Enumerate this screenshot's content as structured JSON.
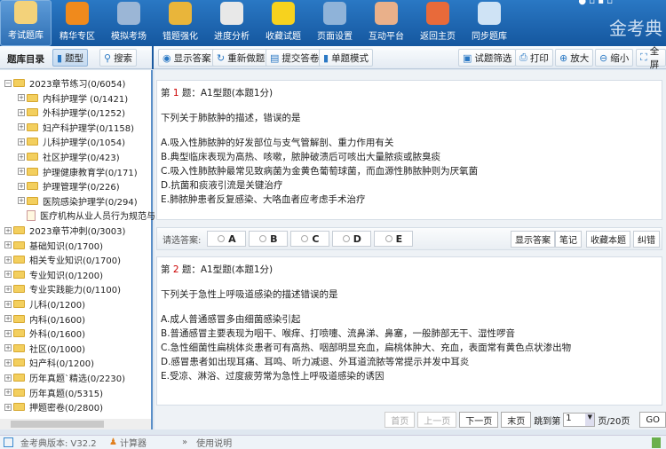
{
  "header": {
    "brand": "金考典",
    "nav": [
      {
        "label": "考试题库",
        "icon": "document-stack-icon",
        "color": "#f3d27a"
      },
      {
        "label": "精华专区",
        "icon": "play-icon",
        "color": "#f08a1c"
      },
      {
        "label": "模拟考场",
        "icon": "monitor-icon",
        "color": "#9bb6d6"
      },
      {
        "label": "错题强化",
        "icon": "lock-chart-icon",
        "color": "#e9b53a"
      },
      {
        "label": "进度分析",
        "icon": "chart-board-icon",
        "color": "#e8e8e8"
      },
      {
        "label": "收藏试题",
        "icon": "star-icon",
        "color": "#f7d21e"
      },
      {
        "label": "页面设置",
        "icon": "gear-icon",
        "color": "#8fb3d9"
      },
      {
        "label": "互动平台",
        "icon": "people-icon",
        "color": "#e9b08a"
      },
      {
        "label": "返回主页",
        "icon": "home-icon",
        "color": "#e86a3a"
      },
      {
        "label": "同步题库",
        "icon": "cloud-sync-icon",
        "color": "#cfe3f5"
      }
    ]
  },
  "sidebar": {
    "title": "题库目录",
    "tab_type": "题型",
    "tab_search": "搜索",
    "tree": [
      {
        "label": "2023章节练习(0/6054)",
        "level": 0,
        "type": "folder",
        "expanded": true
      },
      {
        "label": "内科护理学 (0/1421)",
        "level": 1,
        "type": "folder"
      },
      {
        "label": "外科护理学(0/1252)",
        "level": 1,
        "type": "folder"
      },
      {
        "label": "妇产科护理学(0/1158)",
        "level": 1,
        "type": "folder"
      },
      {
        "label": "儿科护理学(0/1054)",
        "level": 1,
        "type": "folder"
      },
      {
        "label": "社区护理学(0/423)",
        "level": 1,
        "type": "folder"
      },
      {
        "label": "护理健康教育学(0/171)",
        "level": 1,
        "type": "folder"
      },
      {
        "label": "护理管理学(0/226)",
        "level": 1,
        "type": "folder"
      },
      {
        "label": "医院感染护理学(0/294)",
        "level": 1,
        "type": "folder"
      },
      {
        "label": "医疗机构从业人员行为规范与医",
        "level": 1,
        "type": "file"
      },
      {
        "label": "2023章节冲刺(0/3003)",
        "level": 0,
        "type": "folder"
      },
      {
        "label": "基础知识(0/1700)",
        "level": 0,
        "type": "folder"
      },
      {
        "label": "相关专业知识(0/1700)",
        "level": 0,
        "type": "folder"
      },
      {
        "label": "专业知识(0/1200)",
        "level": 0,
        "type": "folder"
      },
      {
        "label": "专业实践能力(0/1100)",
        "level": 0,
        "type": "folder"
      },
      {
        "label": "儿科(0/1200)",
        "level": 0,
        "type": "folder"
      },
      {
        "label": "内科(0/1600)",
        "level": 0,
        "type": "folder"
      },
      {
        "label": "外科(0/1600)",
        "level": 0,
        "type": "folder"
      },
      {
        "label": "社区(0/1000)",
        "level": 0,
        "type": "folder"
      },
      {
        "label": "妇产科(0/1200)",
        "level": 0,
        "type": "folder"
      },
      {
        "label": "历年真题`精选(0/2230)",
        "level": 0,
        "type": "folder"
      },
      {
        "label": "历年真题(0/5315)",
        "level": 0,
        "type": "folder"
      },
      {
        "label": "押题密卷(0/2800)",
        "level": 0,
        "type": "folder"
      }
    ]
  },
  "toolbar": {
    "show_answer": "显示答案",
    "redo": "重新做题",
    "submit": "提交答卷",
    "single_mode": "单题模式",
    "filter": "试题筛选",
    "print": "打印",
    "zoom_in": "放大",
    "zoom_out": "缩小",
    "fullscreen": "全屏"
  },
  "questions": [
    {
      "prefix": "第",
      "num": "1",
      "suffix": "题：A1型题(本题1分)",
      "stem": "下列关于肺脓肿的描述，错误的是",
      "options": [
        "A.吸入性肺脓肿的好发部位与支气管解剖、重力作用有关",
        "B.典型临床表现为高热、咳嗽，脓肿破溃后可咳出大量脓痰或脓臭痰",
        "C.吸入性肺脓肿最常见致病菌为金黄色葡萄球菌，而血源性肺脓肿则为厌氧菌",
        "D.抗菌和痰液引流是关键治疗",
        "E.肺脓肿患者反复感染、大咯血者应考虑手术治疗"
      ]
    },
    {
      "prefix": "第",
      "num": "2",
      "suffix": "题：A1型题(本题1分)",
      "stem": "下列关于急性上呼吸道感染的描述错误的是",
      "options": [
        "A.成人普通感冒多由细菌感染引起",
        "B.普通感冒主要表现为咽干、喉痒、打喷嚏、流鼻涕、鼻塞，一般肺部无干、湿性啰音",
        "C.急性细菌性扁桃体炎患者可有高热、咽部明显充血，扁桃体肿大、充血，表面常有黄色点状渗出物",
        "D.感冒患者如出现耳痛、耳鸣、听力减退、外耳道流脓等常提示并发中耳炎",
        "E.受凉、淋浴、过度疲劳常为急性上呼吸道感染的诱因"
      ]
    }
  ],
  "answer_bar": {
    "label": "请选答案:",
    "choices": [
      "A",
      "B",
      "C",
      "D",
      "E"
    ],
    "show_answer": "显示答案",
    "note": "笔记",
    "favorite": "收藏本题",
    "report": "纠错"
  },
  "pagination": {
    "first": "首页",
    "prev": "上一页",
    "next": "下一页",
    "last": "末页",
    "jump_label": "跳到第",
    "page": "1",
    "total": "页/20页",
    "go": "GO"
  },
  "status": {
    "version": "金考典版本: V32.2",
    "calculator": "计算器",
    "help": "使用说明"
  }
}
